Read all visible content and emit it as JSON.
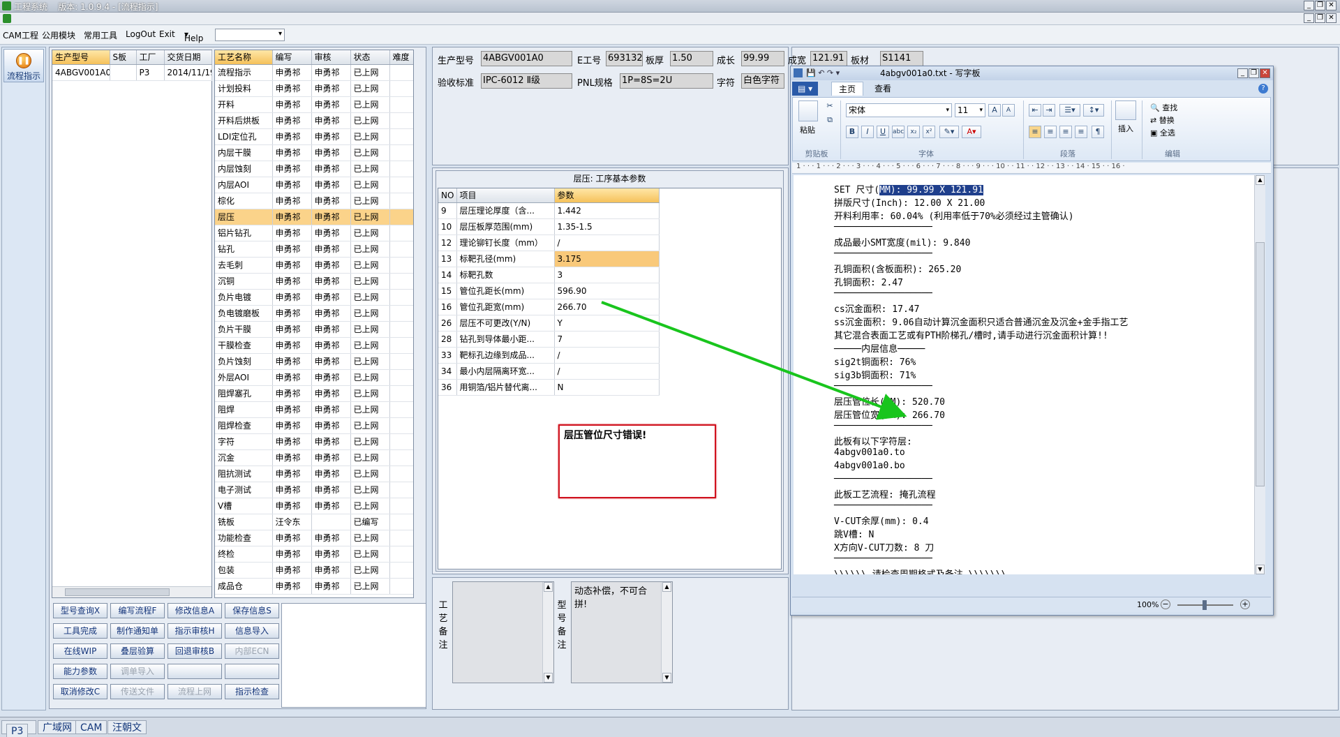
{
  "app": {
    "title": "工程系统",
    "version_label": "版本: 1.0.9.4 - [流程指示]"
  },
  "menu": [
    "CAM工程",
    "公用模块",
    "常用工具",
    "LogOut",
    "Exit",
    "Help"
  ],
  "nav": {
    "button_label": "流程指示"
  },
  "model_table": {
    "headers": [
      "生产型号",
      "S板",
      "工厂",
      "交货日期"
    ],
    "rows": [
      [
        "4ABGV001A0",
        "",
        "P3",
        "2014/11/19"
      ]
    ]
  },
  "process_table": {
    "headers": [
      "工艺名称",
      "编写",
      "审核",
      "状态",
      "难度"
    ],
    "rows": [
      [
        "流程指示",
        "申勇祁",
        "申勇祁",
        "已上网",
        ""
      ],
      [
        "计划投料",
        "申勇祁",
        "申勇祁",
        "已上网",
        ""
      ],
      [
        "开料",
        "申勇祁",
        "申勇祁",
        "已上网",
        ""
      ],
      [
        "开料后烘板",
        "申勇祁",
        "申勇祁",
        "已上网",
        ""
      ],
      [
        "LDI定位孔",
        "申勇祁",
        "申勇祁",
        "已上网",
        ""
      ],
      [
        "内层干膜",
        "申勇祁",
        "申勇祁",
        "已上网",
        ""
      ],
      [
        "内层蚀刻",
        "申勇祁",
        "申勇祁",
        "已上网",
        ""
      ],
      [
        "内层AOI",
        "申勇祁",
        "申勇祁",
        "已上网",
        ""
      ],
      [
        "棕化",
        "申勇祁",
        "申勇祁",
        "已上网",
        ""
      ],
      [
        "层压",
        "申勇祁",
        "申勇祁",
        "已上网",
        ""
      ],
      [
        "铝片钻孔",
        "申勇祁",
        "申勇祁",
        "已上网",
        ""
      ],
      [
        "钻孔",
        "申勇祁",
        "申勇祁",
        "已上网",
        ""
      ],
      [
        "去毛刺",
        "申勇祁",
        "申勇祁",
        "已上网",
        ""
      ],
      [
        "沉铜",
        "申勇祁",
        "申勇祁",
        "已上网",
        ""
      ],
      [
        "负片电镀",
        "申勇祁",
        "申勇祁",
        "已上网",
        ""
      ],
      [
        "负电镀磨板",
        "申勇祁",
        "申勇祁",
        "已上网",
        ""
      ],
      [
        "负片干膜",
        "申勇祁",
        "申勇祁",
        "已上网",
        ""
      ],
      [
        "干膜检查",
        "申勇祁",
        "申勇祁",
        "已上网",
        ""
      ],
      [
        "负片蚀刻",
        "申勇祁",
        "申勇祁",
        "已上网",
        ""
      ],
      [
        "外层AOI",
        "申勇祁",
        "申勇祁",
        "已上网",
        ""
      ],
      [
        "阻焊塞孔",
        "申勇祁",
        "申勇祁",
        "已上网",
        ""
      ],
      [
        "阻焊",
        "申勇祁",
        "申勇祁",
        "已上网",
        ""
      ],
      [
        "阻焊检查",
        "申勇祁",
        "申勇祁",
        "已上网",
        ""
      ],
      [
        "字符",
        "申勇祁",
        "申勇祁",
        "已上网",
        ""
      ],
      [
        "沉金",
        "申勇祁",
        "申勇祁",
        "已上网",
        ""
      ],
      [
        "阻抗测试",
        "申勇祁",
        "申勇祁",
        "已上网",
        ""
      ],
      [
        "电子测试",
        "申勇祁",
        "申勇祁",
        "已上网",
        ""
      ],
      [
        "V槽",
        "申勇祁",
        "申勇祁",
        "已上网",
        ""
      ],
      [
        "铣板",
        "汪令东",
        "",
        "已编写",
        ""
      ],
      [
        "功能检查",
        "申勇祁",
        "申勇祁",
        "已上网",
        ""
      ],
      [
        "终检",
        "申勇祁",
        "申勇祁",
        "已上网",
        ""
      ],
      [
        "包装",
        "申勇祁",
        "申勇祁",
        "已上网",
        ""
      ],
      [
        "成品仓",
        "申勇祁",
        "申勇祁",
        "已上网",
        ""
      ]
    ],
    "selected_index": 9
  },
  "buttons": [
    [
      "型号查询X",
      "编写流程F",
      "修改信息A",
      "保存信息S"
    ],
    [
      "工具完成",
      "制作通知单",
      "指示审核H",
      "信息导入"
    ],
    [
      "在线WIP",
      "叠层验算",
      "回退审核B",
      "内部ECN"
    ],
    [
      "能力参数",
      "调单导入",
      "",
      ""
    ],
    [
      "取消修改C",
      "传送文件",
      "流程上网",
      "指示检查"
    ]
  ],
  "header_fields": {
    "model_label": "生产型号",
    "model_value": "4ABGV001A0",
    "eno_label": "E工号",
    "eno_value": "693132",
    "thick_label": "板厚",
    "thick_value": "1.50",
    "len_label": "成长",
    "len_value": "99.99",
    "width_label": "成宽",
    "width_value": "121.91",
    "mat_label": "板材",
    "mat_value": "S1141",
    "std_label": "验收标准",
    "std_value": "IPC-6012 Ⅱ级",
    "pnl_label": "PNL规格",
    "pnl_value": "1P=8S=2U",
    "char_label": "字符",
    "char_value": "白色字符"
  },
  "params": {
    "title": "层压: 工序基本参数",
    "headers": [
      "NO",
      "项目",
      "参数"
    ],
    "rows": [
      [
        "9",
        "层压理论厚度（含...",
        "1.442"
      ],
      [
        "10",
        "层压板厚范围(mm)",
        "1.35-1.5"
      ],
      [
        "12",
        "理论铆钉长度（mm）",
        "/"
      ],
      [
        "13",
        "标靶孔径(mm)",
        "3.175"
      ],
      [
        "14",
        "标靶孔数",
        "3"
      ],
      [
        "15",
        "管位孔距长(mm)",
        "596.90"
      ],
      [
        "16",
        "管位孔距宽(mm)",
        "266.70"
      ],
      [
        "26",
        "层压不可更改(Y/N)",
        "Y"
      ],
      [
        "28",
        "钻孔到导体最小距...",
        "7"
      ],
      [
        "33",
        "靶标孔边缘到成品...",
        "/"
      ],
      [
        "34",
        "最小内层隔离环宽...",
        "/"
      ],
      [
        "36",
        "用铜箔/铝片替代离...",
        "N"
      ]
    ],
    "highlight_index": 3
  },
  "error_message": "层压管位尺寸错误!",
  "remarks": {
    "process_label": "工艺备注",
    "model_label": "型号备注",
    "model_text": "动态补偿，不可合拼!"
  },
  "wordpad": {
    "title": "4abgv001a0.txt - 写字板",
    "tabs": [
      "主页",
      "查看"
    ],
    "font": "宋体",
    "size": "11",
    "groups": [
      "剪贴板",
      "字体",
      "段落",
      "编辑"
    ],
    "paste": "粘贴",
    "insert": "插入",
    "edit_items": [
      "查找",
      "替换",
      "全选"
    ],
    "ruler": "1 · · · 1 · · · 2 · · · 3 · · · 4 · · · 5 · · · 6 · · · 7 · · · 8 · · · 9 · · · 10 · · 11 · · 12 · · 13 · · 14 · 15 · · 16 ·",
    "zoom": "100%",
    "selected_text": "MM): 99.99 X 121.91",
    "lines": [
      "SET 尺寸(",
      "拼版尺寸(Inch): 12.00 X 21.00",
      "开料利用率: 60.04% (利用率低于70%必须经过主管确认)",
      "──────────────────",
      "成品最小SMT宽度(mil): 9.840",
      "──────────────────",
      "孔铜面积(含板面积): 265.20",
      "孔铜面积: 2.47",
      "──────────────────",
      "cs沉金面积: 17.47",
      "ss沉金面积: 9.06自动计算沉金面积只适合普通沉金及沉金+金手指工艺",
      "其它混合表面工艺或有PTH阶梯孔/槽时,请手动进行沉金面积计算!!",
      "─────内层信息─────",
      "sig2t铜面积: 76%",
      "sig3b铜面积: 71%",
      "──────────────────",
      "层压管位长(MM): 520.70",
      "层压管位宽(MM): 266.70",
      "──────────────────",
      "此板有以下字符层:",
      "4abgv001a0.to",
      "4abgv001a0.bo",
      "──────────────────",
      "此板工艺流程: 掩孔流程",
      "──────────────────",
      "V-CUT余厚(mm): 0.4",
      "跳V槽: N",
      "X方向V-CUT刀数: 8 刀",
      "──────────────────",
      "\\\\\\\\\\\\ 请检查周期格式及备注 \\\\\\\\\\\\\\"
    ]
  },
  "statusbar": [
    "P3",
    "广域网",
    "CAM",
    "汪朝文"
  ],
  "colors": {
    "arrow": "#19c51d",
    "error_border": "#d0121e",
    "highlight": "#fbd38a"
  }
}
